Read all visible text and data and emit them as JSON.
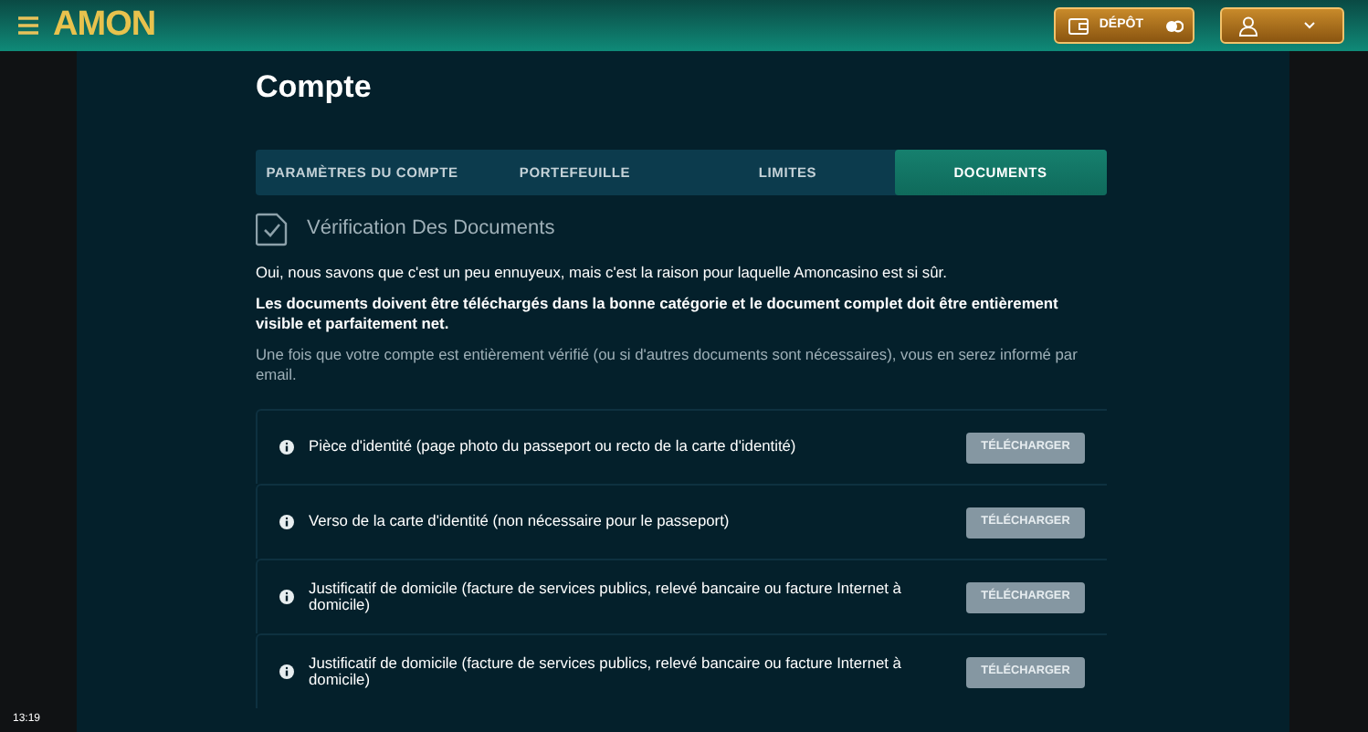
{
  "header": {
    "logo": "AMON",
    "deposit_button": "DÉPÔT"
  },
  "page": {
    "title": "Compte"
  },
  "tabs": [
    {
      "label": "PARAMÈTRES DU COMPTE",
      "selected": false
    },
    {
      "label": "PORTEFEUILLE",
      "selected": false
    },
    {
      "label": "LIMITES",
      "selected": false
    },
    {
      "label": "DOCUMENTS",
      "selected": true
    }
  ],
  "section": {
    "title": "Vérification Des Documents"
  },
  "paragraphs": [
    {
      "text": "Oui, nous savons que c'est un peu ennuyeux, mais c'est la raison pour laquelle Amoncasino est si sûr.",
      "kind": "strong"
    },
    {
      "text": "Les documents doivent être téléchargés dans la bonne catégorie et le document complet doit être entièrement visible et parfaitement net.",
      "kind": "bold"
    },
    {
      "text": "Une fois que votre compte est entièrement vérifié (ou si d'autres documents sont nécessaires), vous en serez informé par email.",
      "kind": "muted"
    }
  ],
  "documents": [
    {
      "label": "Pièce d'identité (page photo du passeport ou recto de la carte d'identité)",
      "button": "TÉLÉCHARGER"
    },
    {
      "label": "Verso de la carte d'identité (non nécessaire pour le passeport)",
      "button": "TÉLÉCHARGER"
    },
    {
      "label": "Justificatif de domicile (facture de services publics, relevé bancaire ou facture Internet à domicile)",
      "button": "TÉLÉCHARGER"
    },
    {
      "label": "Justificatif de domicile (facture de services publics, relevé bancaire ou facture Internet à domicile)",
      "button": "TÉLÉCHARGER"
    }
  ],
  "clock": "13:19"
}
